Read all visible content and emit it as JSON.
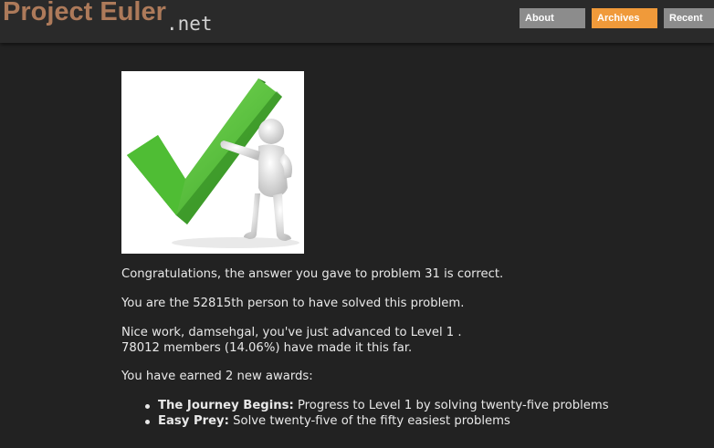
{
  "header": {
    "logo_text": "Project Euler",
    "logo_suffix": ".net",
    "nav": [
      {
        "label": "About"
      },
      {
        "label": "Archives"
      },
      {
        "label": "Recent"
      }
    ]
  },
  "colors": {
    "background": "#222222",
    "logo": "#ad7a5a",
    "nav_button": "#8c8c8c",
    "nav_button_active": "#f09a3a",
    "checkmark": "#55c23a"
  },
  "hero": {
    "icon": "checkmark-with-figure-icon"
  },
  "content": {
    "congrats": "Congratulations, the answer you gave to problem 31 is correct.",
    "solvers": "You are the 52815th person to have solved this problem.",
    "level_line1": "Nice work, damsehgal, you've just advanced to Level 1 .",
    "level_line2": "78012 members (14.06%) have made it this far.",
    "awards_intro": "You have earned 2 new awards:",
    "awards": [
      {
        "name": "The Journey Begins:",
        "description": " Progress to Level 1 by solving twenty-five problems"
      },
      {
        "name": "Easy Prey:",
        "description": " Solve twenty-five of the fifty easiest problems"
      }
    ]
  }
}
